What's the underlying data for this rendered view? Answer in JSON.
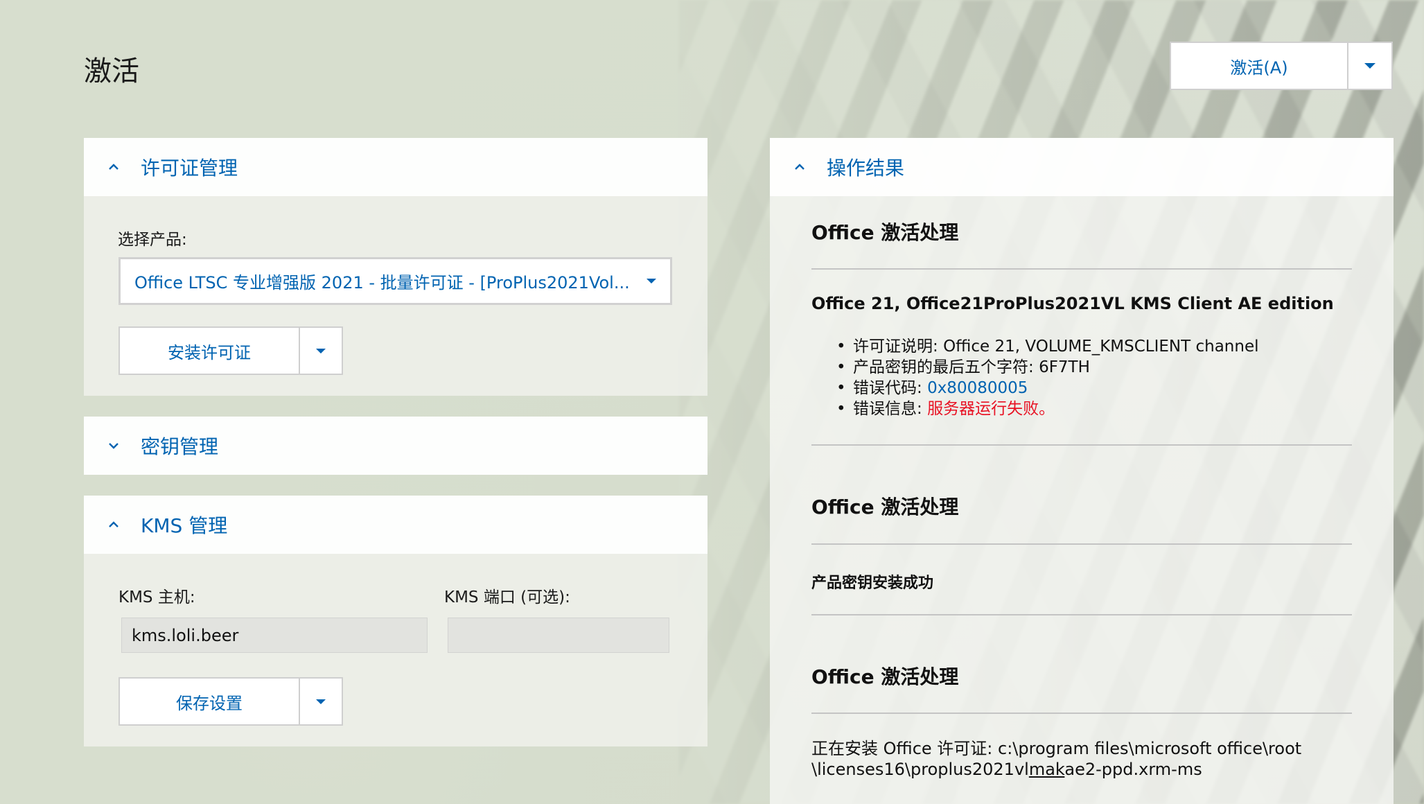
{
  "page": {
    "title": "激活"
  },
  "activate_button": {
    "label": "激活(A)"
  },
  "license_panel": {
    "title": "许可证管理",
    "select_label": "选择产品:",
    "product_value": "Office LTSC 专业增强版 2021 - 批量许可证 - [ProPlus2021Vol...",
    "install_button": "安装许可证"
  },
  "key_panel": {
    "title": "密钥管理"
  },
  "kms_panel": {
    "title": "KMS 管理",
    "host_label": "KMS 主机:",
    "host_value": "kms.loli.beer",
    "port_label": "KMS 端口 (可选):",
    "port_value": "",
    "save_button": "保存设置"
  },
  "results_panel": {
    "title": "操作结果",
    "sections": [
      {
        "heading": "Office 激活处理",
        "subheading": "Office 21, Office21ProPlus2021VL KMS Client AE edition",
        "items": [
          {
            "label": "许可证说明:",
            "value": "Office 21, VOLUME_KMSCLIENT channel"
          },
          {
            "label": "产品密钥的最后五个字符:",
            "value": "6F7TH"
          },
          {
            "label": "错误代码:",
            "value": "0x80080005"
          },
          {
            "label": "错误信息:",
            "value": "服务器运行失败。"
          }
        ]
      },
      {
        "heading": "Office 激活处理",
        "subheading": "产品密钥安装成功"
      },
      {
        "heading": "Office 激活处理",
        "text_line1": "正在安装 Office 许可证: c:\\program files\\microsoft office\\root",
        "text_line2_a": "\\licenses16\\proplus2021vl",
        "text_line2_u": "mak",
        "text_line2_b": "ae2-ppd.xrm-ms"
      }
    ]
  },
  "colors": {
    "accent": "#0063b1",
    "error": "#e81123"
  }
}
